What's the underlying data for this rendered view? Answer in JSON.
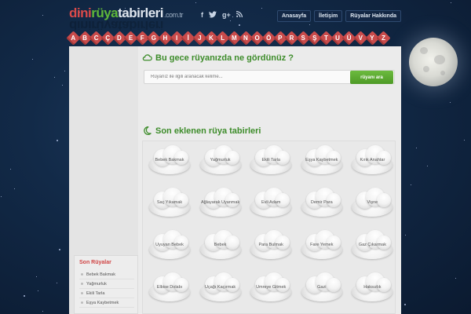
{
  "header": {
    "logo": {
      "part1": "dini",
      "part2": "rüya",
      "part3": "tabirleri",
      "part4": ".com.tr"
    },
    "social": [
      "f",
      "t",
      "g+",
      "rss"
    ],
    "nav": [
      "Anasayfa",
      "İletişim",
      "Rüyalar Hakkında"
    ]
  },
  "letters": [
    "A",
    "B",
    "C",
    "Ç",
    "D",
    "E",
    "F",
    "G",
    "H",
    "I",
    "İ",
    "J",
    "K",
    "L",
    "M",
    "N",
    "O",
    "Ö",
    "P",
    "R",
    "S",
    "Ş",
    "T",
    "U",
    "Ü",
    "V",
    "Y",
    "Z"
  ],
  "search": {
    "title": "Bu gece rüyanızda ne gördünüz ?",
    "placeholder": "Rüyanız ile ilgili aranacak kelime...",
    "button": "rüyanı ara"
  },
  "recent": {
    "title": "Son eklenen rüya tabirleri",
    "items": [
      "Bebek Bakmak",
      "Yağmurluk",
      "Ekili Tarla",
      "Eşya Kaybetmek",
      "Kırık Anahtar",
      "Saç Yıkamak",
      "Ağlayarak Uyanmak",
      "Evli Adam",
      "Demir Para",
      "Vişne",
      "Uyuyan Bebek",
      "Bebek",
      "Para Bulmak",
      "Fare Yemek",
      "Gaz Çıkarmak",
      "Elbise Dolabı",
      "Uçağı Kaçırmak",
      "Umreye Gitmek",
      "Gazi",
      "Haksızlık"
    ]
  },
  "sidebar": {
    "title": "Son Rüyalar",
    "items": [
      "Bebek Bakmak",
      "Yağmurluk",
      "Ekili Tarla",
      "Eşya Kaybetmek"
    ]
  }
}
